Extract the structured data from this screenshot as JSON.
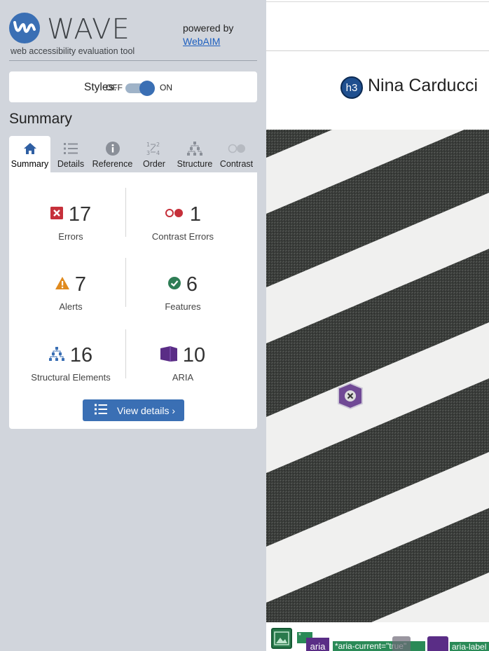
{
  "header": {
    "logo_text": "WAVE",
    "tagline": "web accessibility evaluation tool",
    "powered_by": "powered by",
    "webaim_link": "WebAIM"
  },
  "styles_toggle": {
    "label": "Styles:",
    "off": "OFF",
    "on": "ON",
    "state": "on"
  },
  "summary": {
    "heading": "Summary",
    "tabs": [
      {
        "label": "Summary",
        "icon": "home-icon",
        "active": true
      },
      {
        "label": "Details",
        "icon": "list-icon",
        "active": false
      },
      {
        "label": "Reference",
        "icon": "info-icon",
        "active": false
      },
      {
        "label": "Order",
        "icon": "order-icon",
        "active": false
      },
      {
        "label": "Structure",
        "icon": "structure-icon",
        "active": false
      },
      {
        "label": "Contrast",
        "icon": "contrast-icon",
        "active": false
      }
    ],
    "stats": {
      "errors": {
        "count": "17",
        "label": "Errors"
      },
      "contrast_errors": {
        "count": "1",
        "label": "Contrast Errors"
      },
      "alerts": {
        "count": "7",
        "label": "Alerts"
      },
      "features": {
        "count": "6",
        "label": "Features"
      },
      "structural": {
        "count": "16",
        "label": "Structural Elements"
      },
      "aria": {
        "count": "10",
        "label": "ARIA"
      }
    },
    "view_details_button": "View details ›"
  },
  "preview": {
    "heading_badge": "h3",
    "heading_text": "Nina Carducci",
    "bottom_badges": {
      "aria_icon": "aria",
      "aria_current": "*aria-current=\"true\"",
      "aria_label": "aria-label",
      "green_tag": "*"
    }
  },
  "colors": {
    "sidebar_bg": "#d1d5dc",
    "accent_blue": "#3a6fb4",
    "error_red": "#c0392b",
    "alert_orange": "#e08a1e",
    "feature_green": "#2e8b57",
    "aria_purple": "#5a2d86"
  }
}
